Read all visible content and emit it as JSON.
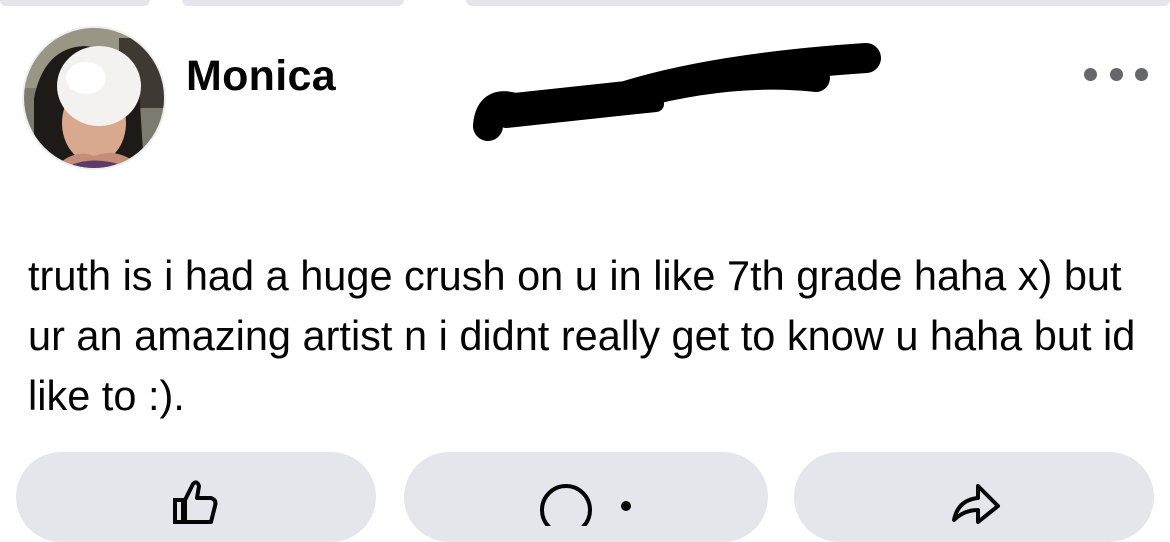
{
  "post": {
    "author_name": "Monica",
    "text": "truth is i had a huge crush on u in like 7th grade haha x) but ur an amazing artist n i didnt really get to know u haha but id like to :)."
  },
  "header": {
    "more_icon": "more-horizontal-icon"
  },
  "actions": [
    {
      "icon": "thumbs-up-icon"
    },
    {
      "icon": "comment-icon"
    },
    {
      "icon": "share-icon"
    }
  ],
  "colors": {
    "background": "#ffffff",
    "text": "#050505",
    "button_bg": "#e4e6eb",
    "icon_gray": "#65676b",
    "redaction": "#000000"
  }
}
